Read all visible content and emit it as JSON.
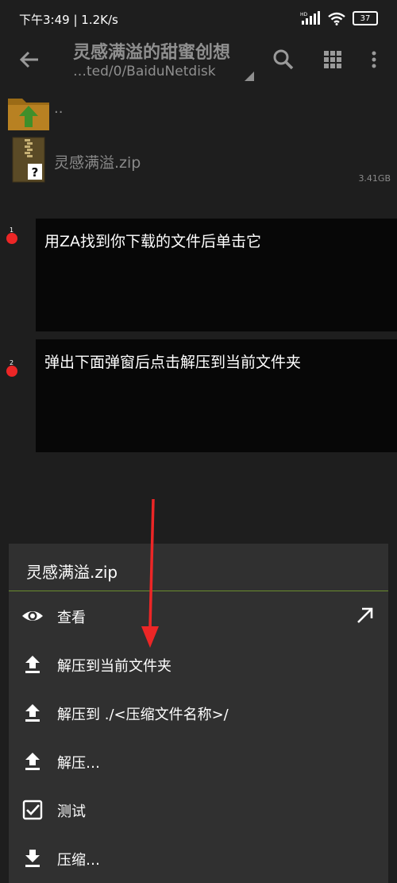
{
  "status": {
    "time_speed": "下午3:49 | 1.2K/s",
    "hd": "HD",
    "battery": "37"
  },
  "toolbar": {
    "title": "灵感满溢的甜蜜创想",
    "path": "…ted/0/BaiduNetdisk"
  },
  "files": {
    "parent_label": "..",
    "zip_name": "灵感满溢.zip",
    "zip_size": "3.41GB"
  },
  "notes": [
    {
      "num": "1",
      "text": "用ZA找到你下载的文件后单击它"
    },
    {
      "num": "2",
      "text": "弹出下面弹窗后点击解压到当前文件夹"
    }
  ],
  "sheet": {
    "title": "灵感满溢.zip",
    "items": [
      {
        "label": "查看",
        "icon": "eye-icon"
      },
      {
        "label": "解压到当前文件夹",
        "icon": "upload-icon"
      },
      {
        "label": "解压到 ./<压缩文件名称>/",
        "icon": "upload-icon"
      },
      {
        "label": "解压…",
        "icon": "upload-icon"
      },
      {
        "label": "测试",
        "icon": "checkbox-icon"
      },
      {
        "label": "压缩…",
        "icon": "download-icon"
      }
    ]
  },
  "colors": {
    "background": "#1e1e1e",
    "sheet": "#303030",
    "accent_divider": "#6b8d2e",
    "annotation_red": "#ec2626"
  }
}
